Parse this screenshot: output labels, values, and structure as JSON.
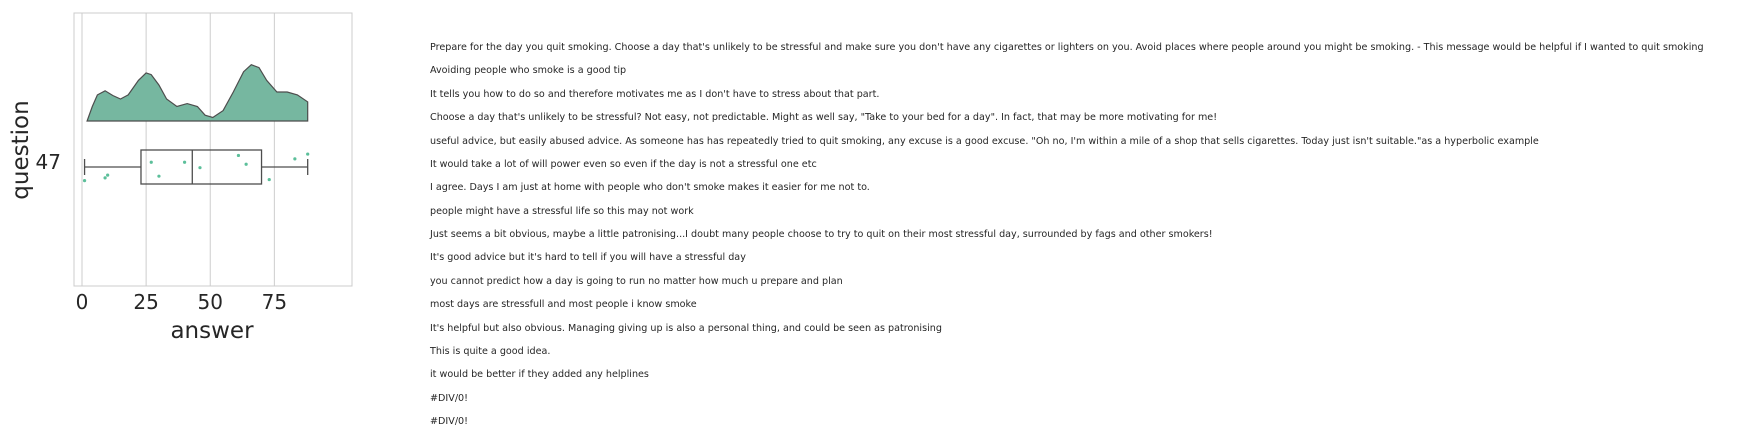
{
  "chart_data": {
    "type": "raincloud",
    "xlabel": "answer",
    "ylabel": "question",
    "categories": [
      "47"
    ],
    "x_ticks": [
      0,
      25,
      50,
      75
    ],
    "xlim": [
      -3,
      93
    ],
    "grid": "vertical",
    "colors": {
      "fill": "#76b7a0",
      "point": "#5cbf9a",
      "line": "#4d4d4d"
    },
    "box": {
      "min": 1,
      "q1": 23,
      "median": 43,
      "q3": 70,
      "max": 88
    },
    "points": [
      {
        "x": 1,
        "j": 0.4
      },
      {
        "x": 9,
        "j": 0.32
      },
      {
        "x": 10,
        "j": 0.24
      },
      {
        "x": 27,
        "j": -0.14
      },
      {
        "x": 30,
        "j": 0.27
      },
      {
        "x": 40,
        "j": -0.14
      },
      {
        "x": 46,
        "j": 0.02
      },
      {
        "x": 61,
        "j": -0.34
      },
      {
        "x": 64,
        "j": -0.08
      },
      {
        "x": 73,
        "j": 0.37
      },
      {
        "x": 83,
        "j": -0.24
      },
      {
        "x": 88,
        "j": -0.38
      }
    ],
    "density": [
      {
        "x": 2,
        "d": 0.0
      },
      {
        "x": 4,
        "d": 0.25
      },
      {
        "x": 6,
        "d": 0.45
      },
      {
        "x": 9,
        "d": 0.52
      },
      {
        "x": 12,
        "d": 0.44
      },
      {
        "x": 15,
        "d": 0.38
      },
      {
        "x": 18,
        "d": 0.45
      },
      {
        "x": 22,
        "d": 0.7
      },
      {
        "x": 25,
        "d": 0.83
      },
      {
        "x": 27,
        "d": 0.8
      },
      {
        "x": 30,
        "d": 0.62
      },
      {
        "x": 33,
        "d": 0.38
      },
      {
        "x": 37,
        "d": 0.25
      },
      {
        "x": 41,
        "d": 0.3
      },
      {
        "x": 45,
        "d": 0.25
      },
      {
        "x": 48,
        "d": 0.1
      },
      {
        "x": 51,
        "d": 0.06
      },
      {
        "x": 55,
        "d": 0.18
      },
      {
        "x": 59,
        "d": 0.5
      },
      {
        "x": 63,
        "d": 0.85
      },
      {
        "x": 66,
        "d": 0.97
      },
      {
        "x": 69,
        "d": 0.92
      },
      {
        "x": 72,
        "d": 0.7
      },
      {
        "x": 76,
        "d": 0.5
      },
      {
        "x": 80,
        "d": 0.5
      },
      {
        "x": 84,
        "d": 0.45
      },
      {
        "x": 88,
        "d": 0.33
      },
      {
        "x": 88,
        "d": 0.0
      }
    ]
  },
  "responses": [
    "Prepare for the day you quit smoking. Choose a day that's unlikely to be stressful and make sure you don't have any cigarettes or lighters on you. Avoid places where people around you might be smoking. - This message would be helpful if I wanted to quit smoking",
    "Avoiding people who smoke is a good tip",
    "It tells you how to do so and therefore motivates me as I don't have to stress about that part.",
    "Choose a day that's unlikely to be stressful? Not easy, not predictable. Might as well say, \"Take to your bed for a day\". In fact, that may be more motivating for me!",
    "useful advice, but easily abused advice. As someone has has repeatedly tried to quit smoking, any excuse is a good excuse. \"Oh no, I'm within a mile of a shop that sells cigarettes. Today just isn't suitable.\"as a hyperbolic example",
    "It would take a lot of will power even so even if the day is not a stressful one etc",
    "I agree. Days I am just at home with people who don't smoke makes it easier for me not to.",
    "people might have a stressful life so this may not work",
    "Just seems a bit obvious, maybe a little patronising...I doubt many people choose to try to quit on their most stressful day, surrounded by fags and other smokers!",
    "It's good advice but it's hard to tell if you will have a stressful day",
    "you cannot predict how a day is going to run no matter how much u prepare and plan",
    "most days are stressfull and most people i know smoke",
    "It's helpful but also obvious. Managing giving up is also a personal thing, and could be seen as patronising",
    "This is quite a good idea.",
    "it would be better if they added any helplines",
    "#DIV/0!",
    "#DIV/0!"
  ]
}
